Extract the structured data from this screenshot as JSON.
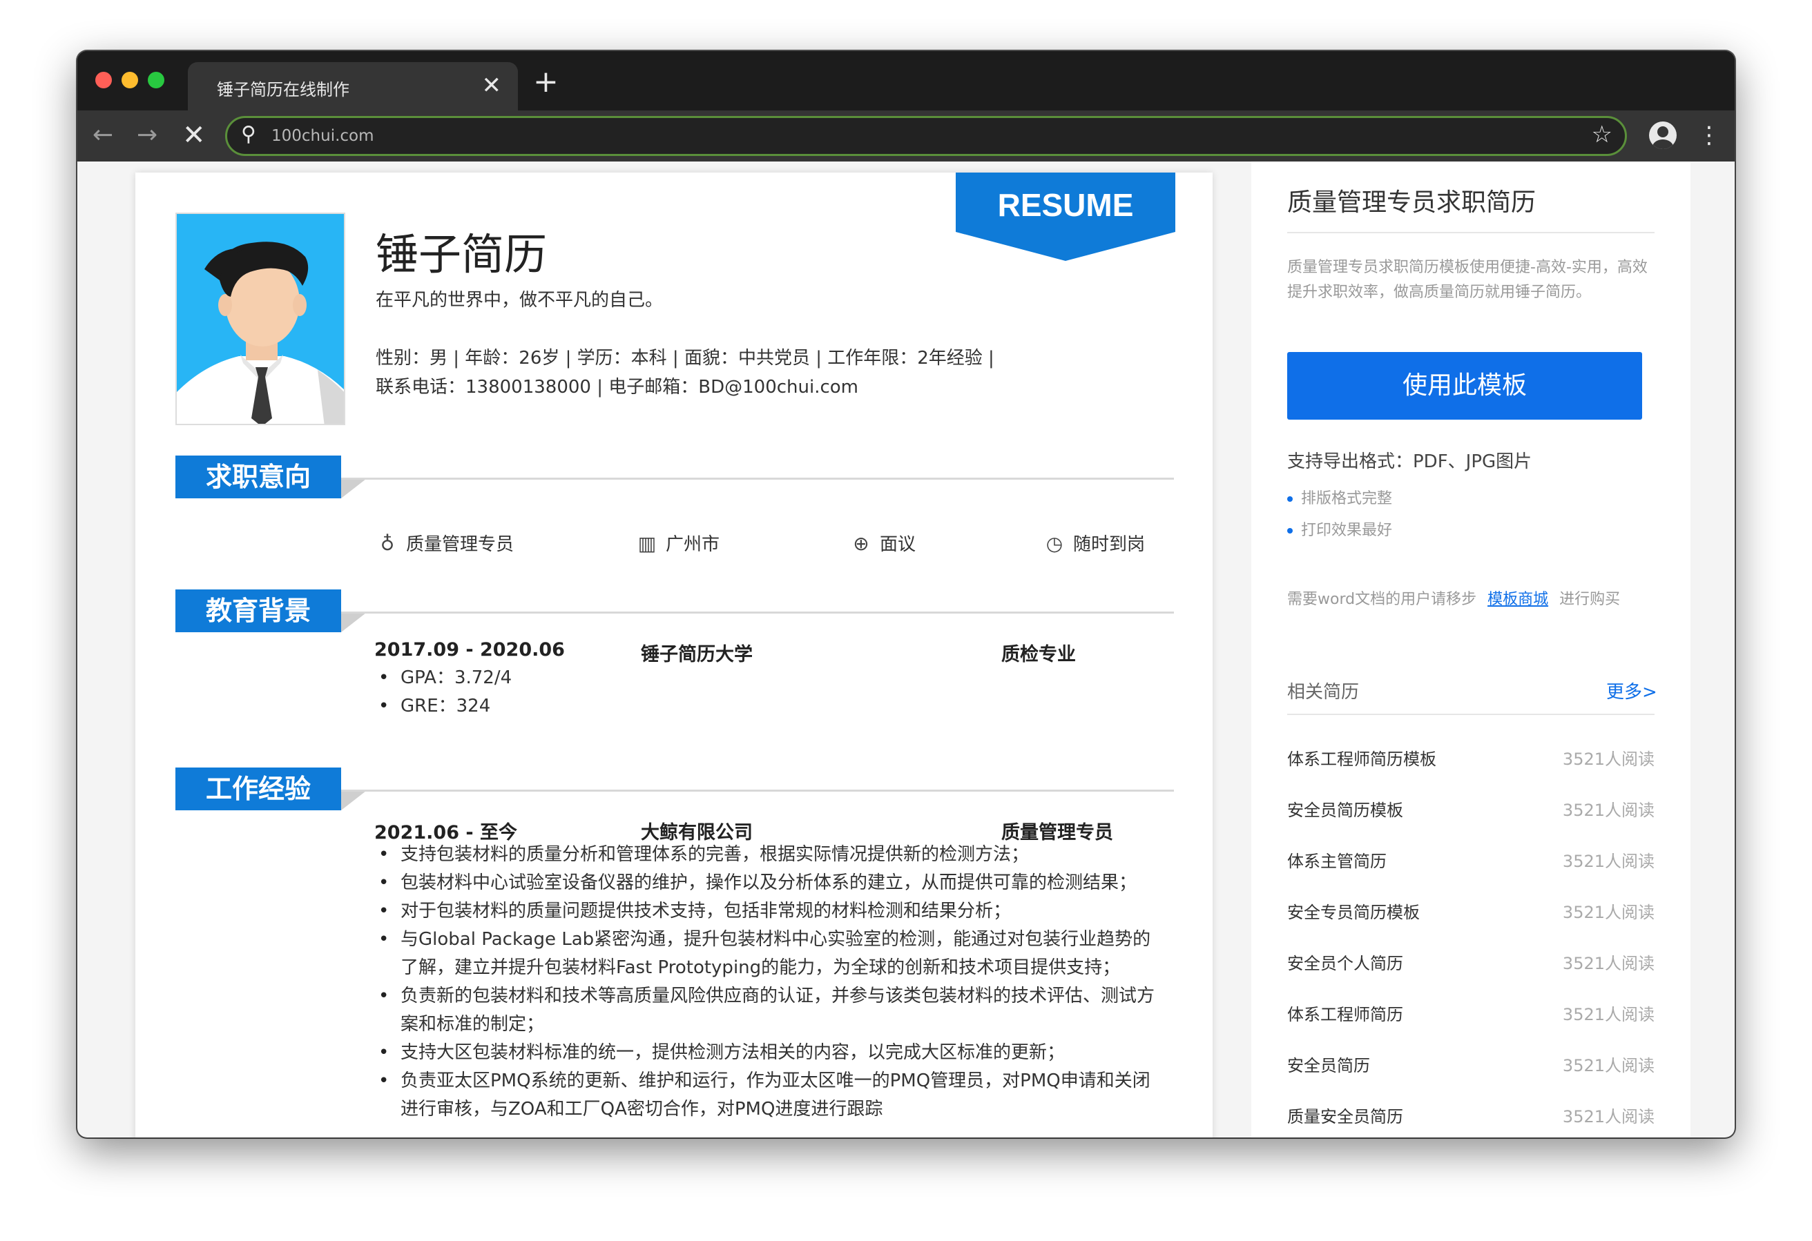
{
  "browser": {
    "tab_title": "锤子简历在线制作",
    "tab_close": "✕",
    "new_tab": "+",
    "back": "←",
    "forward": "→",
    "stop": "✕",
    "url": "100chui.com",
    "search_icon": "⚲",
    "bookmark_icon": "☆",
    "menu_icon": "⋮"
  },
  "resume": {
    "badge": "RESUME",
    "name": "锤子简历",
    "motto": "在平凡的世界中，做不平凡的自己。",
    "info_line1": "性别：男 | 年龄：26岁 | 学历：本科 | 面貌：中共党员 | 工作年限：2年经验 |",
    "info_line2": "联系电话：13800138000 | 电子邮箱：BD@100chui.com",
    "sections": {
      "intent": "求职意向",
      "education": "教育背景",
      "work": "工作经验"
    },
    "intent": {
      "position": "质量管理专员",
      "city": "广州市",
      "salary": "面议",
      "availability": "随时到岗"
    },
    "education": {
      "period": "2017.09 - 2020.06",
      "school": "锤子简历大学",
      "major": "质检专业",
      "bullets": [
        "GPA：3.72/4",
        "GRE：324"
      ]
    },
    "work": {
      "period": "2021.06 - 至今",
      "company": "大鲸有限公司",
      "title": "质量管理专员",
      "bullets": [
        "支持包装材料的质量分析和管理体系的完善，根据实际情况提供新的检测方法；",
        "包装材料中心试验室设备仪器的维护，操作以及分析体系的建立，从而提供可靠的检测结果；",
        "对于包装材料的质量问题提供技术支持，包括非常规的材料检测和结果分析；",
        "与Global Package Lab紧密沟通，提升包装材料中心实验室的检测，能通过对包装行业趋势的了解，建立并提升包装材料Fast Prototyping的能力，为全球的创新和技术项目提供支持；",
        "负责新的包装材料和技术等高质量风险供应商的认证，并参与该类包装材料的技术评估、测试方案和标准的制定；",
        "支持大区包装材料标准的统一，提供检测方法相关的内容，以完成大区标准的更新；",
        "负责亚太区PMQ系统的更新、维护和运行，作为亚太区唯一的PMQ管理员，对PMQ申请和关闭进行审核，与ZOA和工厂QA密切合作，对PMQ进度进行跟踪"
      ]
    }
  },
  "sidebar": {
    "title": "质量管理专员求职简历",
    "description": "质量管理专员求职简历模板使用便捷-高效-实用，高效提升求职效率，做高质量简历就用锤子简历。",
    "use_button": "使用此模板",
    "export_formats": "支持导出格式：PDF、JPG图片",
    "features": [
      "排版格式完整",
      "打印效果最好"
    ],
    "word_note_prefix": "需要word文档的用户请移步",
    "word_link": "模板商城",
    "word_note_suffix": "进行购买",
    "related_label": "相关简历",
    "more_label": "更多>",
    "related": [
      {
        "name": "体系工程师简历模板",
        "count": "3521人阅读"
      },
      {
        "name": "安全员简历模板",
        "count": "3521人阅读"
      },
      {
        "name": "体系主管简历",
        "count": "3521人阅读"
      },
      {
        "name": "安全专员简历模板",
        "count": "3521人阅读"
      },
      {
        "name": "安全员个人简历",
        "count": "3521人阅读"
      },
      {
        "name": "体系工程师简历",
        "count": "3521人阅读"
      },
      {
        "name": "安全员简历",
        "count": "3521人阅读"
      },
      {
        "name": "质量安全员简历",
        "count": "3521人阅读"
      }
    ]
  },
  "colors": {
    "accent": "#0f7bd8",
    "button": "#0f6fe8",
    "photo_bg": "#28b5f5"
  }
}
